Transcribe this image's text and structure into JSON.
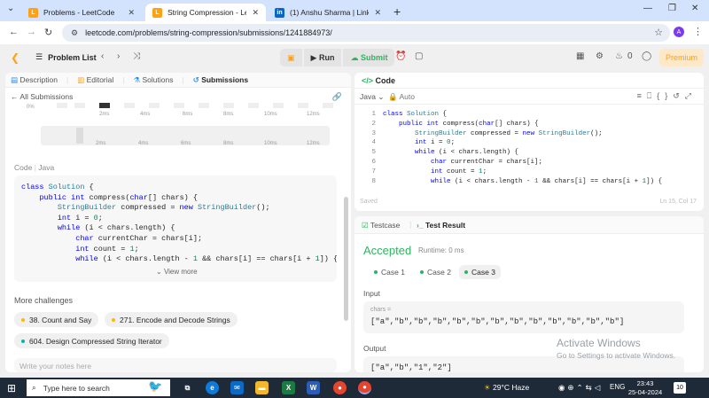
{
  "browser": {
    "tabs": [
      {
        "title": "Problems - LeetCode",
        "favicon": "leetcode-favicon"
      },
      {
        "title": "String Compression - LeetCode",
        "favicon": "leetcode-favicon"
      },
      {
        "title": "(1) Anshu Sharma | LinkedIn",
        "favicon": "linkedin-favicon"
      }
    ],
    "url": "leetcode.com/problems/string-compression/submissions/1241884973/",
    "profile_initial": "A"
  },
  "nav": {
    "problem_list": "Problem List",
    "run": "Run",
    "submit": "Submit",
    "streak": "0",
    "premium": "Premium"
  },
  "left": {
    "tabs": [
      "Description",
      "Editorial",
      "Solutions",
      "Submissions"
    ],
    "all_submissions": "All Submissions",
    "chart_pct": "0%",
    "axis_top": [
      "2ms",
      "4ms",
      "6ms",
      "8ms",
      "10ms",
      "12ms"
    ],
    "axis_bottom": [
      "2ms",
      "4ms",
      "6ms",
      "8ms",
      "10ms",
      "12ms"
    ],
    "code_label": "Code",
    "lang_label": "Java",
    "view_more": "View more",
    "more_challenges": "More challenges",
    "challenges": [
      {
        "label": "38. Count and Say",
        "color": "#ffb800"
      },
      {
        "label": "271. Encode and Decode Strings",
        "color": "#ffb800"
      },
      {
        "label": "604. Design Compressed String Iterator",
        "color": "#00b8a3"
      }
    ],
    "notes_placeholder": "Write your notes here"
  },
  "code": {
    "header": "Code",
    "language": "Java",
    "auto": "Auto",
    "saved": "Saved",
    "position": "Ln 15, Col 17",
    "line_numbers": "1\n2\n3\n4\n5\n6\n7\n8"
  },
  "test": {
    "testcase_tab": "Testcase",
    "result_tab": "Test Result",
    "status": "Accepted",
    "runtime": "Runtime: 0 ms",
    "cases": [
      "Case 1",
      "Case 2",
      "Case 3"
    ],
    "input_label": "Input",
    "input_name": "chars =",
    "input_value": "[\"a\",\"b\",\"b\",\"b\",\"b\",\"b\",\"b\",\"b\",\"b\",\"b\",\"b\",\"b\",\"b\"]",
    "output_label": "Output",
    "output_value": "[\"a\",\"b\",\"1\",\"2\"]"
  },
  "watermark": {
    "line1": "Activate Windows",
    "line2": "Go to Settings to activate Windows."
  },
  "taskbar": {
    "search": "Type here to search",
    "weather": "29°C  Haze",
    "lang": "ENG",
    "time": "23:43",
    "date": "25-04-2024",
    "notif": "10"
  }
}
